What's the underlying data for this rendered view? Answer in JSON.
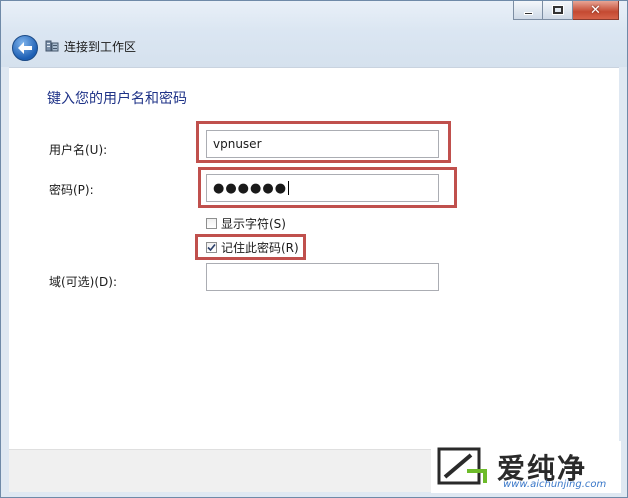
{
  "window": {
    "nav_title": "连接到工作区"
  },
  "form": {
    "heading": "键入您的用户名和密码",
    "username": {
      "label": "用户名(U):",
      "value": "vpnuser"
    },
    "password": {
      "label": "密码(P):",
      "masked_value": "●●●●●●"
    },
    "show_chars": {
      "label": "显示字符(S)",
      "checked": false
    },
    "remember": {
      "label": "记住此密码(R)",
      "checked": true
    },
    "domain": {
      "label": "域(可选)(D):",
      "value": ""
    }
  },
  "watermark": {
    "name": "爱纯净",
    "url": "www.aichunjing.com"
  },
  "colors": {
    "highlight": "#c0504d",
    "heading": "#1e3287"
  }
}
